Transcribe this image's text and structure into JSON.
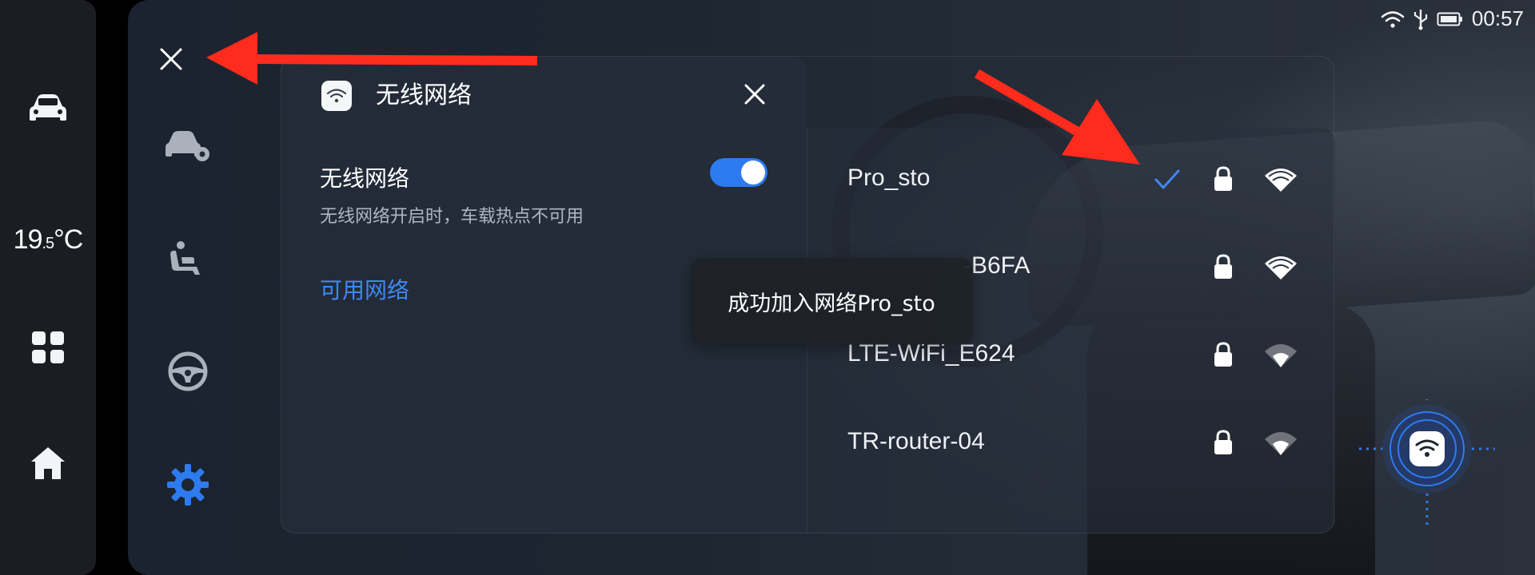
{
  "status_bar": {
    "time": "00:57",
    "icons": [
      "wifi-icon",
      "usb-icon",
      "battery-icon"
    ]
  },
  "dock": {
    "temperature_main": "19",
    "temperature_decimal": ".5",
    "temperature_unit": "°C",
    "icons": [
      "car-icon",
      "apps-grid-icon",
      "home-icon"
    ]
  },
  "settings_nav": {
    "icons": [
      "car-settings-icon",
      "seat-icon",
      "steering-wheel-icon",
      "settings-gear-icon"
    ],
    "active": "settings-gear-icon",
    "active_color": "#2e7bf0"
  },
  "dialog": {
    "title": "无线网络",
    "wifi_toggle_label": "无线网络",
    "wifi_toggle_desc": "无线网络开启时，车载热点不可用",
    "wifi_enabled": true,
    "available_networks_title": "可用网络"
  },
  "networks": [
    {
      "name": "Pro_sto",
      "connected": true,
      "locked": true,
      "signal": "strong"
    },
    {
      "name": "-B6FA",
      "connected": false,
      "locked": true,
      "signal": "strong"
    },
    {
      "name": "LTE-WiFi_E624",
      "connected": false,
      "locked": true,
      "signal": "weak"
    },
    {
      "name": "TR-router-04",
      "connected": false,
      "locked": true,
      "signal": "weak"
    }
  ],
  "toast": {
    "message": "成功加入网络Pro_sto"
  },
  "colors": {
    "accent": "#2e7bf0",
    "annotation_arrow": "#ff2b1c"
  }
}
